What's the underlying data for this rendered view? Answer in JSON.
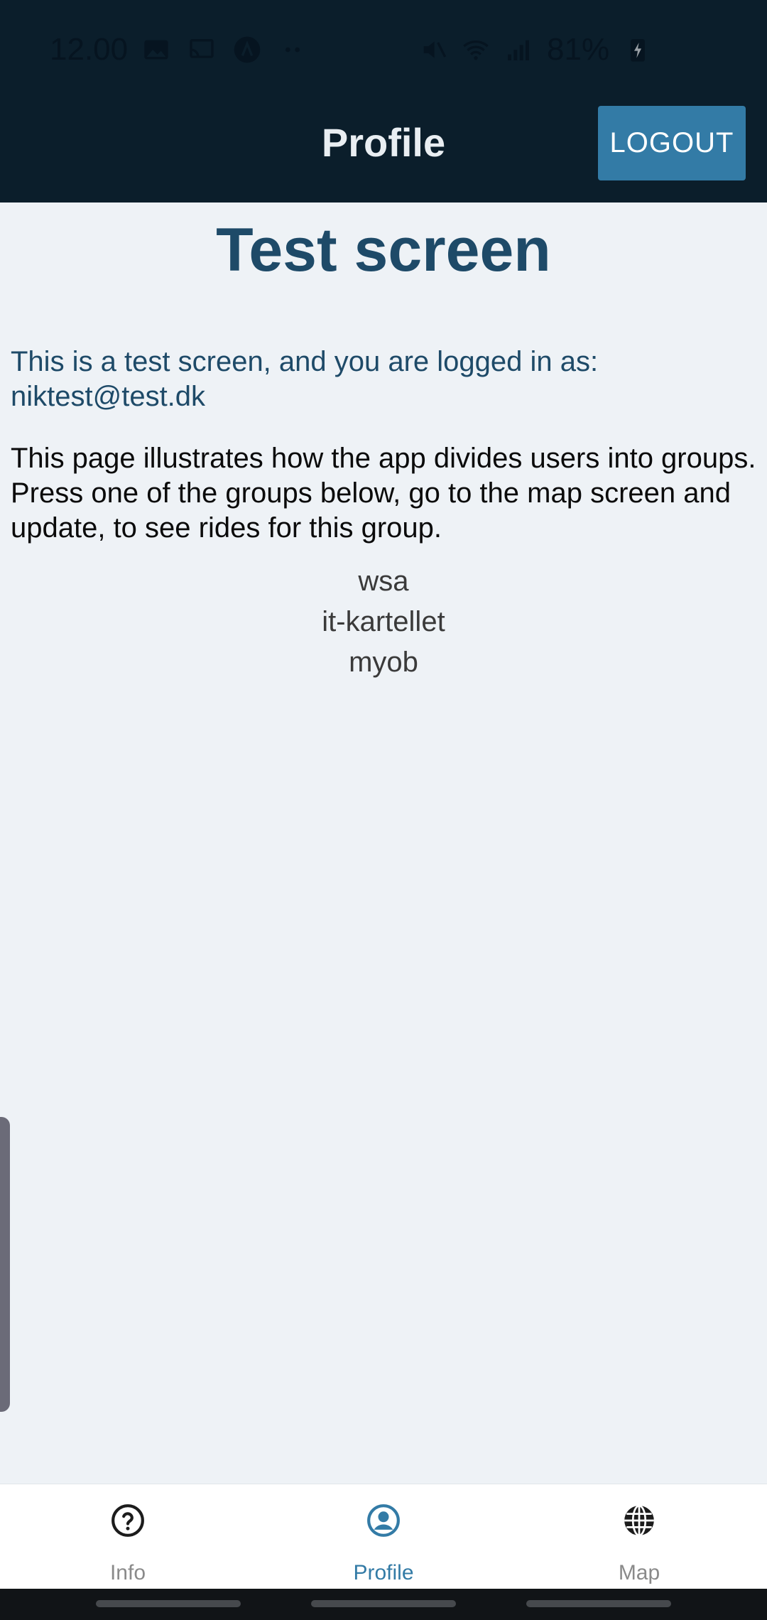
{
  "status_bar": {
    "time": "12.00",
    "battery": "81%"
  },
  "header": {
    "title": "Profile",
    "logout_label": "LOGOUT"
  },
  "main": {
    "title": "Test screen",
    "logged_in_text": "This is a test screen, and you are logged in as: niktest@test.dk",
    "description": "This page illustrates how the app divides users into groups. Press one of the groups below, go to the map screen and update, to see rides for this group.",
    "groups": [
      "wsa",
      "it-kartellet",
      "myob"
    ]
  },
  "tabs": [
    {
      "label": "Info",
      "icon": "question-circle-icon"
    },
    {
      "label": "Profile",
      "icon": "user-circle-icon",
      "active": true
    },
    {
      "label": "Map",
      "icon": "globe-icon"
    }
  ],
  "colors": {
    "header_bg": "#0b1e2b",
    "accent": "#337ba6",
    "title_color": "#1e4a68",
    "content_bg": "#eef2f6"
  }
}
